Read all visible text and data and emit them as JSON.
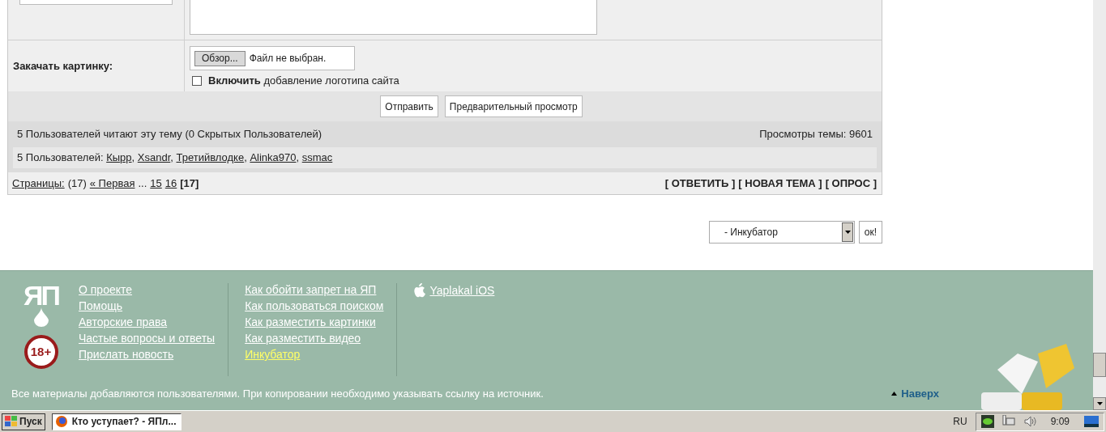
{
  "form": {
    "upload_label": "Закачать картинку:",
    "browse_button": "Обзор...",
    "file_status": "Файл не выбран.",
    "logo_option": {
      "text": "**Включить** добавление логотипа сайта",
      "checked": false
    },
    "buttons": [
      "Отправить",
      "Предварительный просмотр"
    ]
  },
  "readers": {
    "summary": "5 Пользователей читают эту тему (0 Скрытых Пользователей)",
    "views": "Просмотры темы: 9601",
    "users_label": "5 Пользователей:",
    "users": [
      "Кырр",
      "Xsandr",
      "Третийвлодке",
      "Alinka970",
      "ssmac"
    ],
    "separator": ","
  },
  "pagination": {
    "label": "Страницы:",
    "count": "(17)",
    "first": "« Первая",
    "ellipsis": "...",
    "pages": [
      {
        "label": "15",
        "selected": false
      },
      {
        "label": "16",
        "selected": false
      },
      {
        "label": "[17]",
        "selected": true
      }
    ]
  },
  "actions": [
    "[ ОТВЕТИТЬ ]",
    "[ НОВАЯ ТЕМА ]",
    "[ ОПРОС ]"
  ],
  "forum_jump": {
    "value": "- Инкубатор",
    "button": "ок!"
  },
  "footer": {
    "logo": "ЯП",
    "badge": "18+",
    "columns": [
      [
        {
          "label": "О проекте",
          "selected": false
        },
        {
          "label": "Помощь",
          "selected": false
        },
        {
          "label": "Авторские права",
          "selected": false
        },
        {
          "label": "Частые вопросы и ответы",
          "selected": false
        },
        {
          "label": "Прислать новость",
          "selected": false
        }
      ],
      [
        {
          "label": "Как обойти запрет на ЯП",
          "selected": false
        },
        {
          "label": "Как пользоваться поиском",
          "selected": false
        },
        {
          "label": "Как разместить картинки",
          "selected": false
        },
        {
          "label": "Как разместить видео",
          "selected": false
        },
        {
          "label": "Инкубатор",
          "selected": true
        }
      ],
      [
        {
          "label": "Yaplakal iOS",
          "selected": false
        }
      ]
    ],
    "notice": "Все материалы добавляются пользователями. При копировании необходимо указывать ссылку на источник.",
    "back_to_top": "Наверх"
  },
  "taskbar": {
    "start": "Пуск",
    "windows": [
      {
        "title": "Кто уступает? - ЯПл...",
        "selected": true
      }
    ],
    "language": "RU",
    "clock": "9:09"
  }
}
